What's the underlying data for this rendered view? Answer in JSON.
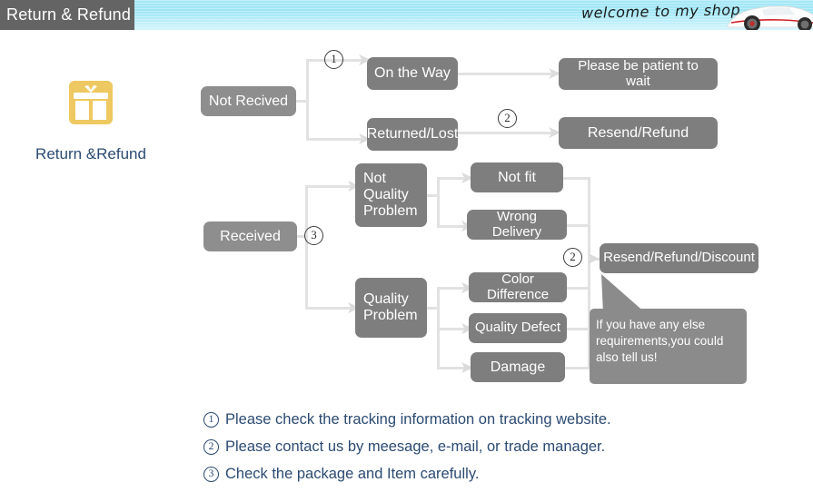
{
  "header": {
    "tab_label": "Return & Refund",
    "welcome_text": "welcome to my shop",
    "car_icon": "sports-car-image"
  },
  "badge": {
    "icon": "gift-box-icon",
    "label": "Return &Refund",
    "icon_color": "#eec860",
    "label_color": "#2b4a72"
  },
  "flow": {
    "not_received": "Not Recived",
    "on_the_way": "On the Way",
    "returned_lost": "Returned/Lost",
    "please_wait": "Please be patient to wait",
    "resend_refund": "Resend/Refund",
    "received": "Received",
    "not_quality_problem": "Not\nQuality\nProblem",
    "not_quality_problem_l1": "Not",
    "not_quality_problem_l2": "Quality",
    "not_quality_problem_l3": "Problem",
    "quality_problem_l1": "Quality",
    "quality_problem_l2": "Problem",
    "not_fit": "Not fit",
    "wrong_delivery": "Wrong Delivery",
    "color_difference": "Color Difference",
    "quality_defect": "Quality Defect",
    "damage": "Damage",
    "resend_refund_discount": "Resend/Refund/Discount",
    "box_color": "#7e7e7e",
    "connector_color": "#e2e2e2"
  },
  "markers": {
    "m1": "1",
    "m2": "2",
    "m3": "3",
    "m4": "2"
  },
  "bubble": {
    "line1": "If you have any else",
    "line2": "requirements,you could",
    "line3": "also tell us!"
  },
  "notes": [
    {
      "num": "1",
      "text": "Please check the tracking information on tracking website."
    },
    {
      "num": "2",
      "text": "Please contact us by meesage, e-mail, or trade manager."
    },
    {
      "num": "3",
      "text": "Check the package and Item carefully."
    }
  ]
}
